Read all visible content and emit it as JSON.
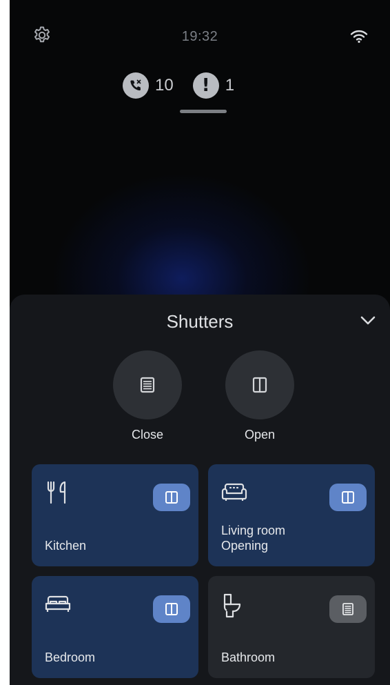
{
  "status_bar": {
    "time": "19:32",
    "settings_icon": "gear-icon",
    "wifi_icon": "wifi-icon"
  },
  "notifications": [
    {
      "icon": "missed-call-icon",
      "count": "10"
    },
    {
      "icon": "alert-icon",
      "symbol": "!",
      "count": "1"
    }
  ],
  "sheet": {
    "title": "Shutters",
    "collapse_icon": "chevron-down-icon",
    "actions": [
      {
        "label": "Close",
        "icon": "shutter-closed-icon"
      },
      {
        "label": "Open",
        "icon": "shutter-open-icon"
      }
    ],
    "rooms": [
      {
        "name": "Kitchen",
        "status": "",
        "icon": "kitchen-icon",
        "state_icon": "shutter-open-icon",
        "active": true
      },
      {
        "name": "Living room",
        "status": "Opening",
        "icon": "sofa-icon",
        "state_icon": "shutter-open-icon",
        "active": true
      },
      {
        "name": "Bedroom",
        "status": "",
        "icon": "bed-icon",
        "state_icon": "shutter-open-icon",
        "active": true
      },
      {
        "name": "Bathroom",
        "status": "",
        "icon": "toilet-icon",
        "state_icon": "shutter-closed-icon",
        "active": false
      }
    ]
  },
  "colors": {
    "background": "#060708",
    "sheet": "#15171b",
    "tile_active": "#1d3357",
    "tile_inactive": "#24272c",
    "badge_active": "#5f84c8",
    "badge_inactive": "#5b5e63"
  }
}
